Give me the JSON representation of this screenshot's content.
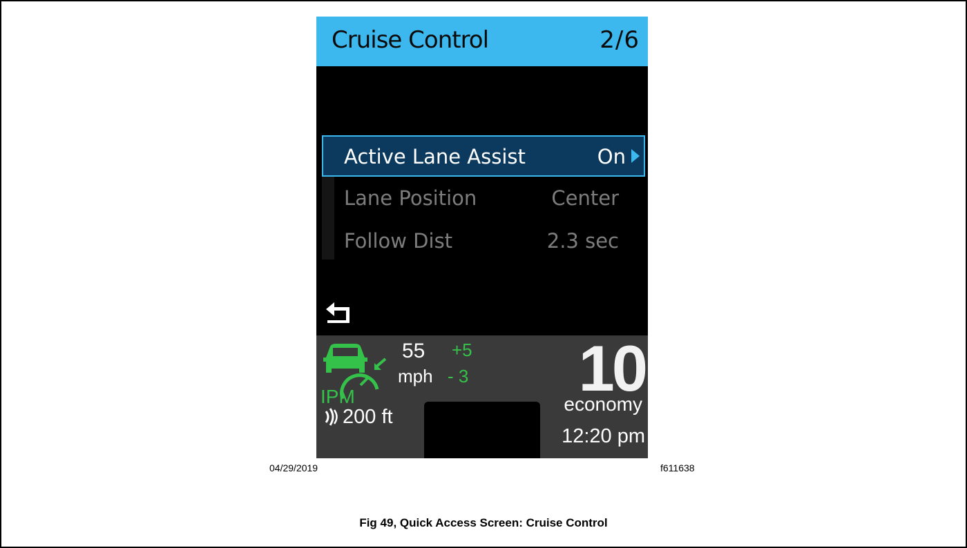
{
  "screen": {
    "header": {
      "title": "Cruise Control",
      "page": "2/6"
    },
    "menu": [
      {
        "label": "Active Lane Assist",
        "value": "On",
        "selected": true
      },
      {
        "label": "Lane Position",
        "value": "Center",
        "selected": false
      },
      {
        "label": "Follow Dist",
        "value": "2.3 sec",
        "selected": false
      }
    ],
    "status": {
      "ipm_label": "IPM",
      "speed": "55",
      "speed_unit": "mph",
      "plus_offset": "+5",
      "minus_offset": "- 3",
      "distance": "200 ft",
      "economy_value": "10",
      "economy_label": "economy",
      "time": "12:20 pm"
    },
    "colors": {
      "accent": "#3db8ef",
      "green": "#35c24a",
      "status_bg": "#3a3a3a"
    },
    "icons": [
      "back-arrow-icon",
      "scroll-down-icon",
      "right-arrow-icon",
      "ipm-car-gauge-icon",
      "signal-waves-icon"
    ]
  },
  "figure": {
    "date": "04/29/2019",
    "id": "f611638",
    "caption": "Fig 49, Quick Access Screen: Cruise Control"
  }
}
